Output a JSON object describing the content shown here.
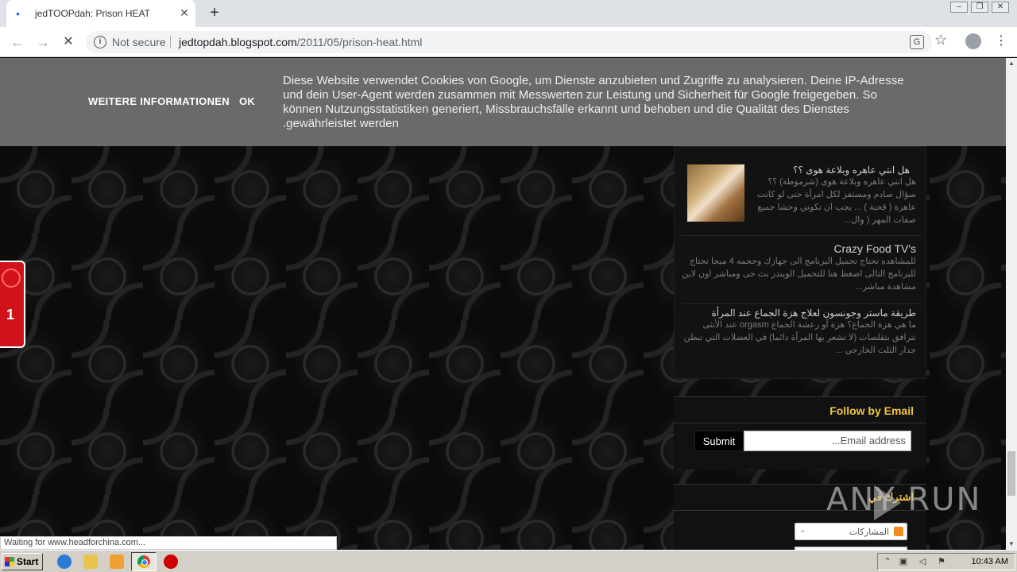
{
  "browser": {
    "tab_title": "jedTOOPdah: Prison HEAT",
    "tab_close": "✕",
    "new_tab": "+",
    "security_label": "Not secure",
    "url_host": "jedtopdah.blogspot.com",
    "url_path": "/2011/05/prison-heat.html",
    "status_text": "Waiting for www.headforchina.com..."
  },
  "cookie_bar": {
    "more_info": "WEITERE INFORMATIONEN",
    "ok": "OK",
    "text": "Diese Website verwendet Cookies von Google, um Dienste anzubieten und Zugriffe zu analysieren. Deine IP-Adresse und dein User-Agent werden zusammen mit Messwerten zur Leistung und Sicherheit für Google freigegeben. So können Nutzungsstatistiken generiert, Missbrauchsfälle erkannt und behoben und die Qualität des Dienstes gewährleistet werden."
  },
  "popular_posts": [
    {
      "title": "هل انتي عاهره وبلاعة هوى ؟؟",
      "snippet": "هل انتي عاهره وبلاعة هوى (شرموطة) ؟؟ سؤال صادم ومستفز لكل امرأة حتى لو كانت عاهرة ( قحبة ) ... يجب ان تكوني وحشا جميع صفات المهر ( وال..."
    },
    {
      "title": "Crazy Food TV's",
      "snippet": "للمشاهده تحتاج تحميل البرنامج الى جهازك وحجمه 4 ميجا تحتاج للبرنامج التالى اضغط هنا للتحميل الويندز بث حى ومباشر اون لاين مشاهدة مباشر..."
    },
    {
      "title": "طريقة ماستر وجونسون لعلاج هزة الجماع عند المرأة",
      "snippet": "ما هي هزة الجماع؟ هزة أو رعشة الجماع orgasm عند الأنثى تترافق بتقلصات (لا تشعر بها المرأة دائما) في العضلات التي تبطن جدار الثلث الخارجي ..."
    }
  ],
  "follow": {
    "title": "Follow by Email",
    "placeholder": "Email address...",
    "submit": "Submit"
  },
  "subscribe": {
    "title": "اشترك في",
    "dropdown_label": "المشاركات"
  },
  "side_widget": {
    "number": "1"
  },
  "watermark": "ANY RUN",
  "taskbar": {
    "start": "Start",
    "clock": "10:43 AM"
  }
}
